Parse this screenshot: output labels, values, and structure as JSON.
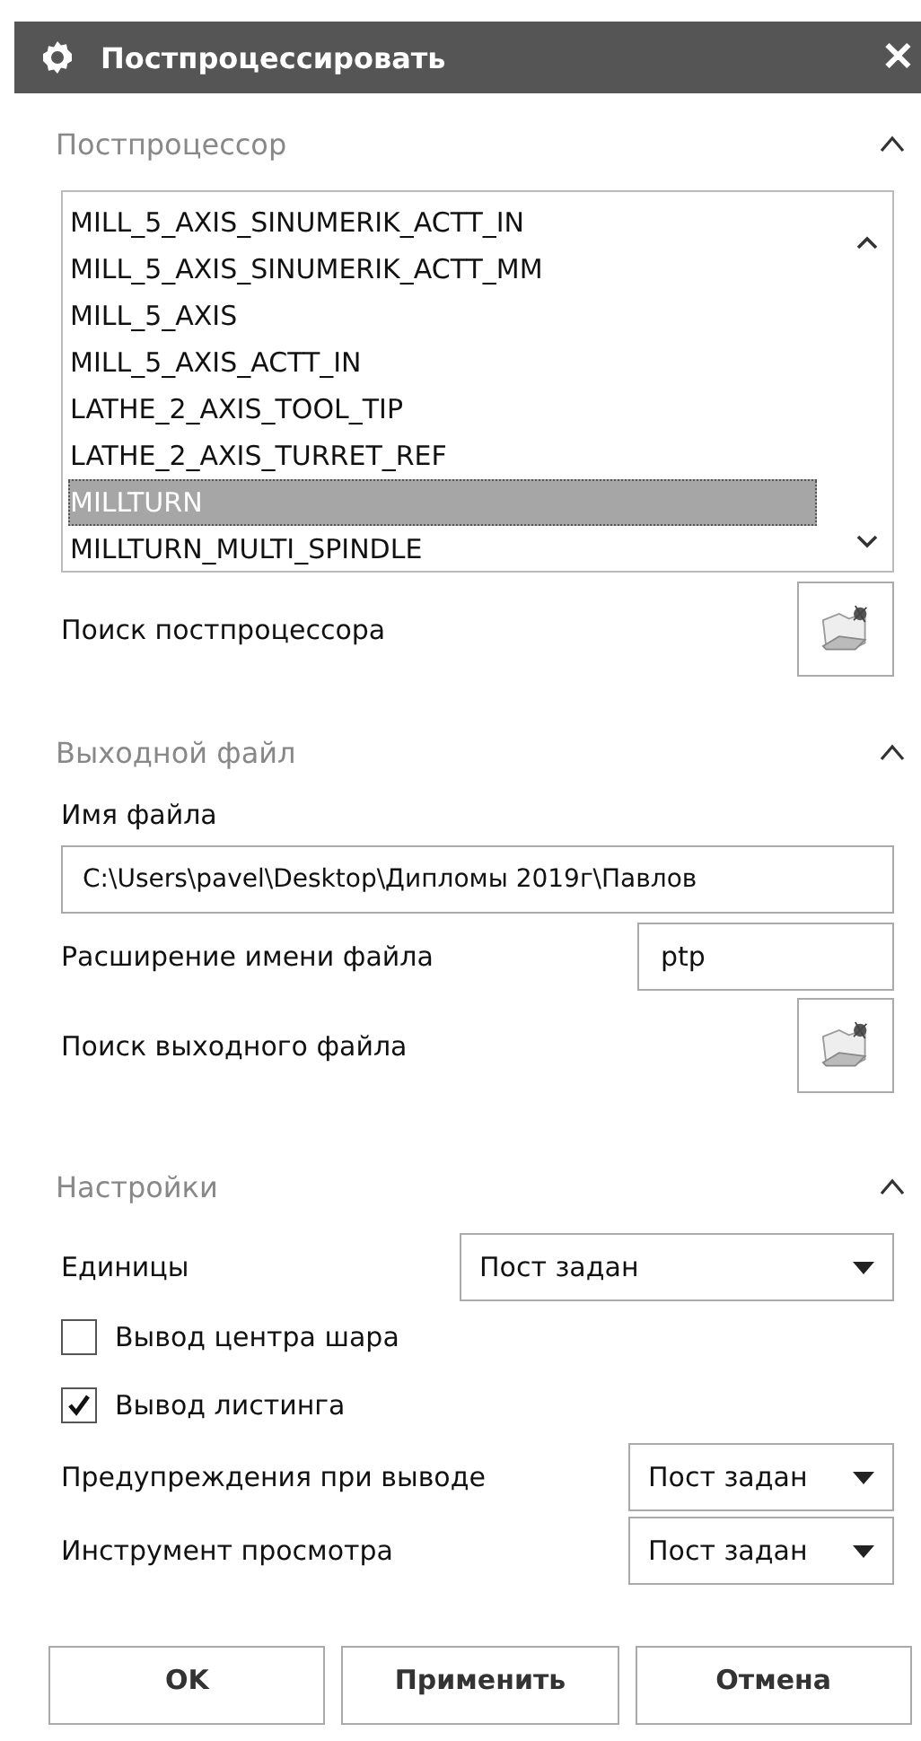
{
  "window": {
    "title": "Постпроцессировать",
    "close": "✕"
  },
  "postprocessor": {
    "title": "Постпроцессор",
    "expanded": true,
    "items": [
      {
        "label": "MILL_5_AXIS_SINUMERIK_ACTT_IN",
        "selected": false
      },
      {
        "label": "MILL_5_AXIS_SINUMERIK_ACTT_MM",
        "selected": false
      },
      {
        "label": "MILL_5_AXIS",
        "selected": false
      },
      {
        "label": "MILL_5_AXIS_ACTT_IN",
        "selected": false
      },
      {
        "label": "LATHE_2_AXIS_TOOL_TIP",
        "selected": false
      },
      {
        "label": "LATHE_2_AXIS_TURRET_REF",
        "selected": false
      },
      {
        "label": "MILLTURN",
        "selected": true
      },
      {
        "label": "MILLTURN_MULTI_SPINDLE",
        "selected": false
      }
    ],
    "browse_label": "Поиск постпроцессора"
  },
  "output_file": {
    "title": "Выходной файл",
    "expanded": true,
    "name_label": "Имя файла",
    "name_value": "C:\\Users\\pavel\\Desktop\\Дипломы 2019г\\Павлов",
    "ext_label": "Расширение имени файла",
    "ext_value": "ptp",
    "browse_label": "Поиск выходного файла"
  },
  "settings": {
    "title": "Настройки",
    "expanded": true,
    "rows": [
      {
        "kind": "dropdown",
        "label": "Единицы",
        "value": "Пост задан",
        "wide": true
      },
      {
        "kind": "checkbox",
        "label": "Вывод центра шара",
        "checked": false
      },
      {
        "kind": "checkbox",
        "label": "Вывод листинга",
        "checked": true
      },
      {
        "kind": "dropdown",
        "label": "Предупреждения при выводе",
        "value": "Пост задан",
        "wide": false
      },
      {
        "kind": "dropdown",
        "label": "Инструмент просмотра",
        "value": "Пост задан",
        "wide": false
      }
    ]
  },
  "buttons": [
    "OK",
    "Применить",
    "Отмена"
  ]
}
